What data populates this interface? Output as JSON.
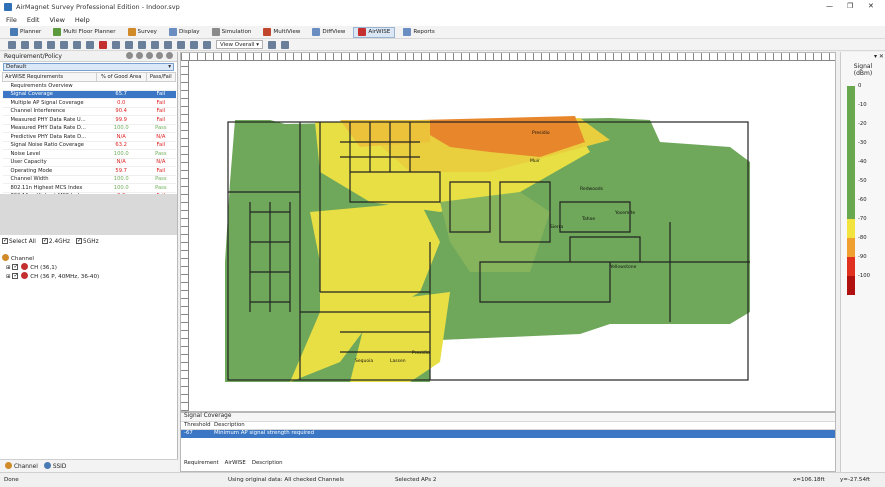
{
  "window": {
    "title": "AirMagnet Survey Professional Edition - Indoor.svp",
    "controls": [
      "—",
      "❐",
      "✕"
    ]
  },
  "menu": [
    "File",
    "Edit",
    "View",
    "Help"
  ],
  "tabs": [
    {
      "label": "Planner",
      "color": "#4a7ab3"
    },
    {
      "label": "Multi Floor Planner",
      "color": "#5b9a3d"
    },
    {
      "label": "Survey",
      "color": "#d08a27"
    },
    {
      "label": "Display",
      "color": "#6a8ec2"
    },
    {
      "label": "Simulation",
      "color": "#8a8a8a"
    },
    {
      "label": "MultiView",
      "color": "#c0462d"
    },
    {
      "label": "DiffView",
      "color": "#6a8ec2"
    },
    {
      "label": "AirWISE",
      "color": "#c43030",
      "active": true
    },
    {
      "label": "Reports",
      "color": "#6a8ec2"
    }
  ],
  "toolbar": {
    "view_select": "View Overall"
  },
  "left_panel": {
    "title": "Requirement/Policy",
    "policy_value": "Default",
    "columns": [
      "AirWISE Requirements",
      "% of Good Area",
      "Pass/Fail"
    ],
    "overview_label": "Requirements Overview",
    "rows": [
      {
        "name": "Signal Coverage",
        "pct": "65.7",
        "status": "Fail",
        "selected": true
      },
      {
        "name": "Multiple AP Signal Coverage",
        "pct": "0.0",
        "status": "Fail"
      },
      {
        "name": "Channel Interference",
        "pct": "90.4",
        "status": "Fail"
      },
      {
        "name": "Measured PHY Data Rate U...",
        "pct": "99.9",
        "status": "Fail"
      },
      {
        "name": "Measured PHY Data Rate D...",
        "pct": "100.0",
        "status": "Pass"
      },
      {
        "name": "Predictive PHY Data Rate D...",
        "pct": "N/A",
        "status": "N/A"
      },
      {
        "name": "Signal Noise Ratio Coverage",
        "pct": "63.2",
        "status": "Fail"
      },
      {
        "name": "Noise Level",
        "pct": "100.0",
        "status": "Pass"
      },
      {
        "name": "User Capacity",
        "pct": "N/A",
        "status": "N/A"
      },
      {
        "name": "Operating Mode",
        "pct": "59.7",
        "status": "Fail"
      },
      {
        "name": "Channel Width",
        "pct": "100.0",
        "status": "Pass"
      },
      {
        "name": "802.11n Highest MCS Index",
        "pct": "100.0",
        "status": "Pass"
      },
      {
        "name": "802.11ac Highest MCS Index",
        "pct": "0.0",
        "status": "Fail"
      }
    ],
    "checks": [
      "Select All",
      "2.4GHz",
      "5GHz"
    ],
    "tree": {
      "root": "Channel",
      "items": [
        "CH (36,1)",
        "CH (36 P, 40MHz, 36-40)"
      ]
    },
    "bottom_tabs": [
      "Channel",
      "SSID"
    ]
  },
  "bottom_panel": {
    "title": "Signal Coverage",
    "columns": [
      "Threshold",
      "Description"
    ],
    "row": {
      "threshold": "-67",
      "description": "Minimum AP signal strength required"
    },
    "tabs": [
      "Requirement",
      "AirWISE",
      "Description"
    ]
  },
  "map_labels": [
    "Presidio",
    "Redwoods",
    "Sequoia",
    "Tahoe",
    "Yosemite",
    "Sierra",
    "Yellowstone",
    "Lassen",
    "Presidio",
    "Muir"
  ],
  "legend": {
    "title_line1": "Signal",
    "title_line2": "(dBm)",
    "stops": [
      {
        "label": "0",
        "color": "#6aa84f"
      },
      {
        "label": "-10",
        "color": "#6aa84f"
      },
      {
        "label": "-20",
        "color": "#6aa84f"
      },
      {
        "label": "-30",
        "color": "#6aa84f"
      },
      {
        "label": "-40",
        "color": "#6aa84f"
      },
      {
        "label": "-50",
        "color": "#6aa84f"
      },
      {
        "label": "-60",
        "color": "#6aa84f"
      },
      {
        "label": "-70",
        "color": "#f2e33f"
      },
      {
        "label": "-80",
        "color": "#f0a030"
      },
      {
        "label": "-90",
        "color": "#e03020"
      },
      {
        "label": "-100",
        "color": "#b01010"
      }
    ]
  },
  "status": {
    "left": "Done",
    "middle": "Using original data: All checked Channels",
    "aps": "Selected APs 2",
    "x": "x=106.18ft",
    "y": "y=-27.54ft"
  }
}
